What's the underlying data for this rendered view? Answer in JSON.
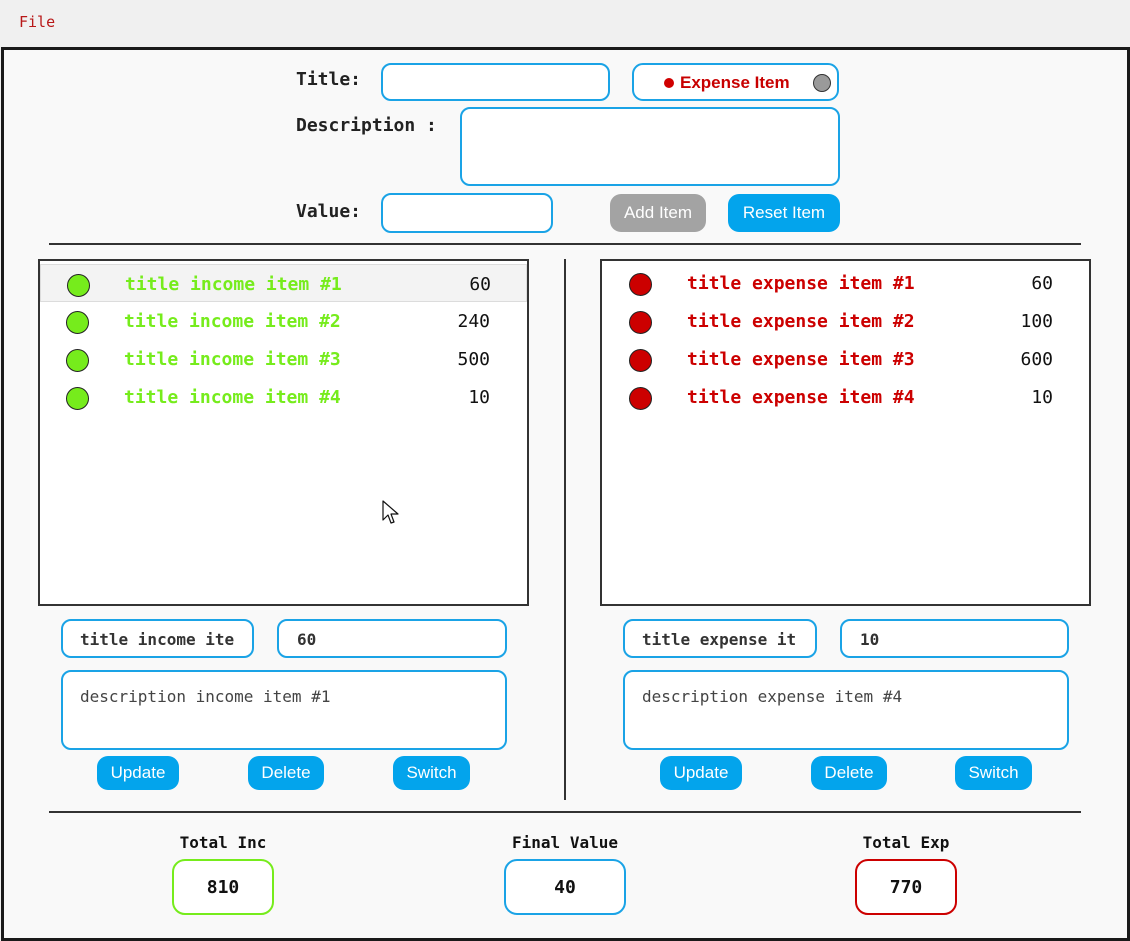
{
  "menu": {
    "file": "File"
  },
  "form": {
    "title_label": "Title:",
    "title_value": "",
    "description_label": "Description :",
    "description_value": "",
    "value_label": "Value:",
    "value_value": "",
    "toggle_label": "Expense Item",
    "add_button": "Add Item",
    "reset_button": "Reset Item"
  },
  "income": {
    "items": [
      {
        "title": "title income item #1",
        "value": "60"
      },
      {
        "title": "title income item #2",
        "value": "240"
      },
      {
        "title": "title income item #3",
        "value": "500"
      },
      {
        "title": "title income item #4",
        "value": "10"
      }
    ],
    "edit_title": "title income ite",
    "edit_value": "60",
    "edit_description": "description income item #1",
    "update_button": "Update",
    "delete_button": "Delete",
    "switch_button": "Switch"
  },
  "expense": {
    "items": [
      {
        "title": "title expense item #1",
        "value": "60"
      },
      {
        "title": "title expense item #2",
        "value": "100"
      },
      {
        "title": "title expense item #3",
        "value": "600"
      },
      {
        "title": "title expense item #4",
        "value": "10"
      }
    ],
    "edit_title": "title expense it",
    "edit_value": "10",
    "edit_description": "description expense item #4",
    "update_button": "Update",
    "delete_button": "Delete",
    "switch_button": "Switch"
  },
  "totals": {
    "income_label": "Total Inc",
    "income_value": "810",
    "final_label": "Final Value",
    "final_value": "40",
    "expense_label": "Total Exp",
    "expense_value": "770"
  },
  "colors": {
    "income": "#76ec1c",
    "expense": "#cc0000",
    "accent": "#1aa3e6",
    "button": "#03a4ec"
  }
}
